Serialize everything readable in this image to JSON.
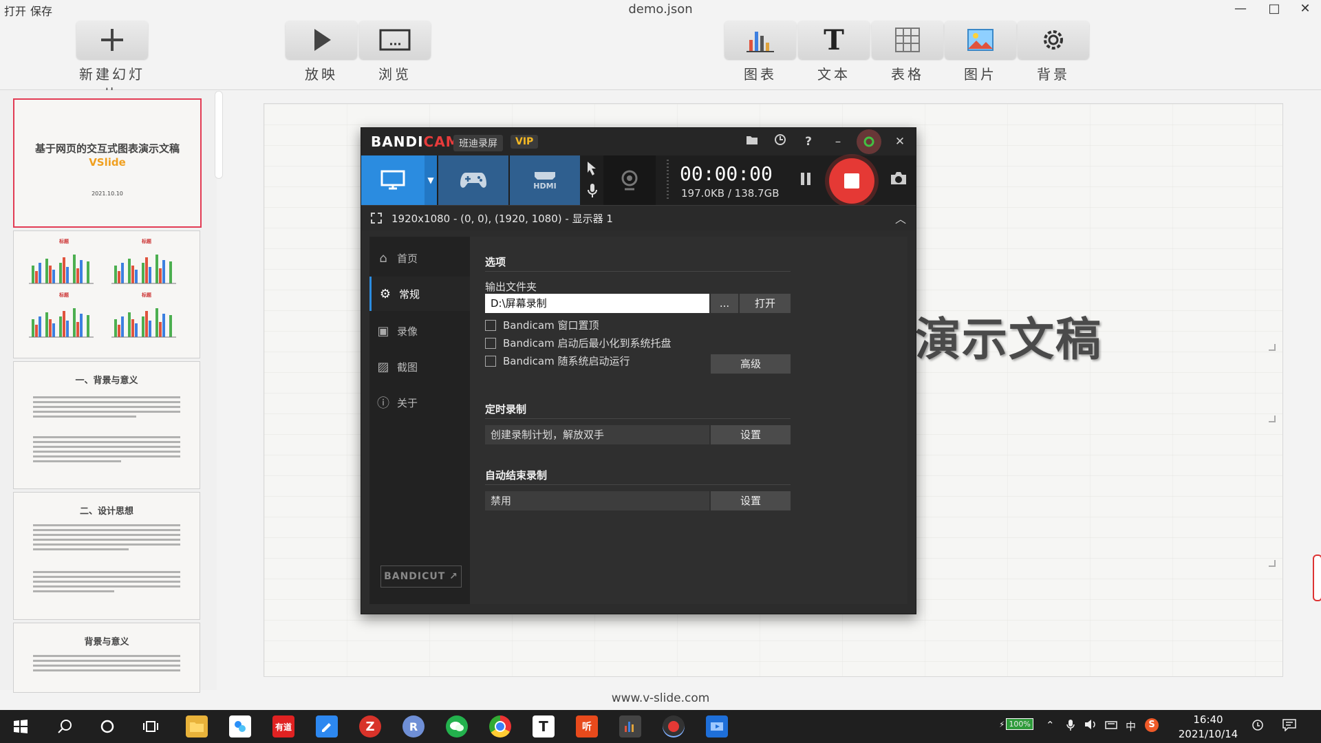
{
  "titlebar": {
    "menu": [
      "打开",
      "保存"
    ],
    "title": "demo.json",
    "controls": [
      "—",
      "□",
      "✕"
    ]
  },
  "toolbar": {
    "new_slide": "新建幻灯片",
    "play": "放映",
    "browse": "浏览",
    "chart": "图表",
    "text": "文本",
    "table": "表格",
    "image": "图片",
    "background": "背景"
  },
  "slides": [
    {
      "title": "基于网页的交互式图表演示文稿",
      "subtitle": "VSlide",
      "date": "2021.10.10"
    },
    {
      "chart_label": "标题"
    },
    {
      "title": "一、背景与意义"
    },
    {
      "title": "二、设计思想"
    },
    {
      "title": "背景与意义"
    }
  ],
  "canvas": {
    "visible_title": "演示文稿",
    "footer_url": "www.v-slide.com"
  },
  "bandicam": {
    "logo_main": "BANDI",
    "logo_cam": "CAM",
    "tag": "班迪录屏",
    "vip": "VIP",
    "timer": "00:00:00",
    "size": "197.0KB / 138.7GB",
    "region": "1920x1080 - (0, 0), (1920, 1080) - 显示器 1",
    "hdmi_label": "HDMI",
    "sidebar": [
      "首页",
      "常规",
      "录像",
      "截图",
      "关于"
    ],
    "bandicut": "BANDICUT",
    "options": {
      "section": "选项",
      "output_label": "输出文件夹",
      "output_value": "D:\\屏幕录制",
      "browse": "...",
      "open": "打开",
      "checkboxes": [
        "Bandicam 窗口置顶",
        "Bandicam 启动后最小化到系统托盘",
        "Bandicam 随系统启动运行"
      ],
      "advanced": "高级"
    },
    "scheduled": {
      "section": "定时录制",
      "value": "创建录制计划，解放双手",
      "button": "设置"
    },
    "auto_stop": {
      "section": "自动结束录制",
      "value": "禁用",
      "button": "设置"
    }
  },
  "taskbar": {
    "battery": "100%",
    "ime": "中",
    "time": "16:40",
    "date": "2021/10/14",
    "apps": [
      "有道",
      "R",
      "T",
      "听"
    ]
  }
}
